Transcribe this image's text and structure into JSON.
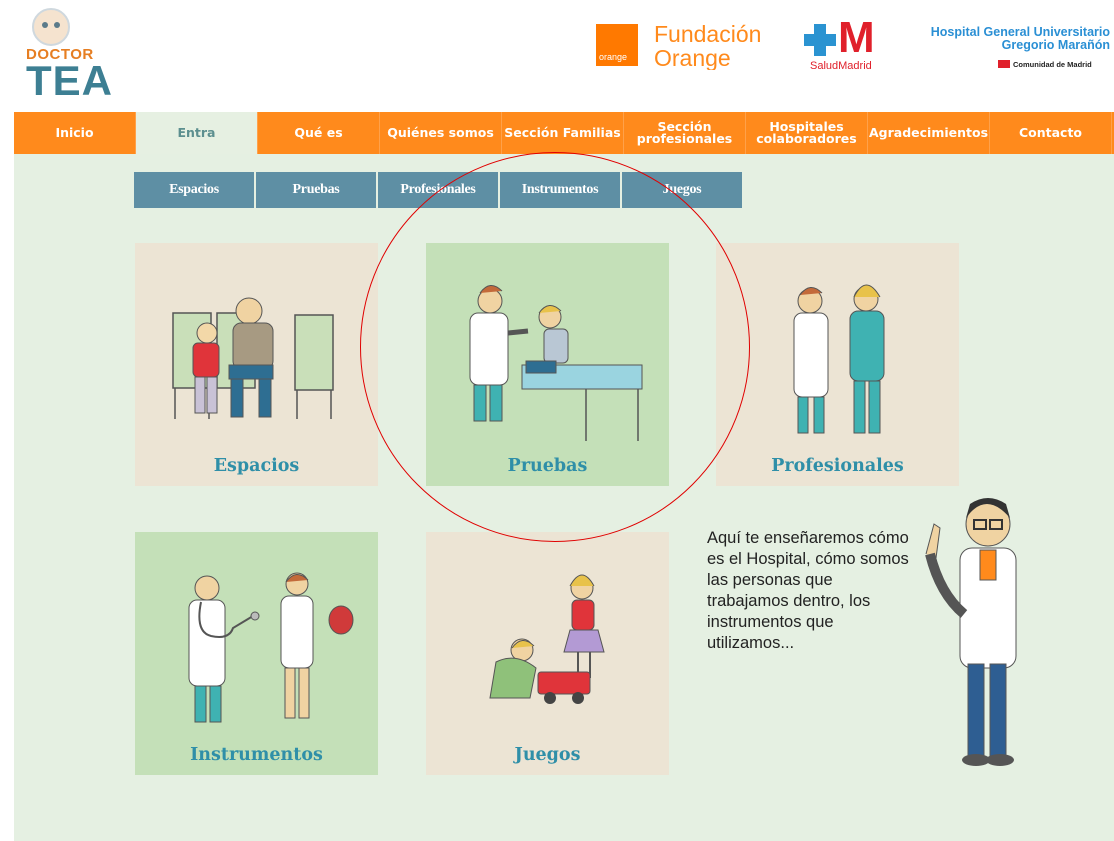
{
  "header": {
    "logo": {
      "line1": "DOCTOR",
      "line2": "TEA"
    },
    "orange_logo": {
      "label": "orange",
      "text": "Fundación Orange"
    },
    "salud_madrid": {
      "text": "SaludMadrid"
    },
    "hospital": {
      "name": "Hospital General Universitario Gregorio Marañón",
      "sub": "Comunidad de Madrid"
    }
  },
  "nav": {
    "items": [
      {
        "label": "Inicio"
      },
      {
        "label": "Entra"
      },
      {
        "label": "Qué es"
      },
      {
        "label": "Quiénes somos"
      },
      {
        "label": "Sección Familias"
      },
      {
        "label": "Sección profesionales"
      },
      {
        "label": "Hospitales colaboradores"
      },
      {
        "label": "Agradecimientos"
      },
      {
        "label": "Contacto"
      }
    ],
    "active": "Entra"
  },
  "subnav": {
    "items": [
      {
        "label": "Espacios"
      },
      {
        "label": "Pruebas"
      },
      {
        "label": "Profesionales"
      },
      {
        "label": "Instrumentos"
      },
      {
        "label": "Juegos"
      }
    ]
  },
  "cards": [
    {
      "label": "Espacios",
      "icon": "waiting-room-illustration"
    },
    {
      "label": "Pruebas",
      "icon": "medical-exam-illustration"
    },
    {
      "label": "Profesionales",
      "icon": "doctor-nurse-illustration"
    },
    {
      "label": "Instrumentos",
      "icon": "stethoscope-illustration"
    },
    {
      "label": "Juegos",
      "icon": "children-playing-illustration"
    }
  ],
  "intro_text": "Aquí te enseñaremos cómo es el Hospital, cómo somos las personas que trabajamos dentro, los instrumentos que utilizamos...",
  "colors": {
    "nav_orange": "#ff8a1c",
    "subnav_blue": "#5e8fa4",
    "page_green": "#e5f0e2",
    "label_teal": "#2f8fa8",
    "highlight_circle": "#e00000"
  }
}
